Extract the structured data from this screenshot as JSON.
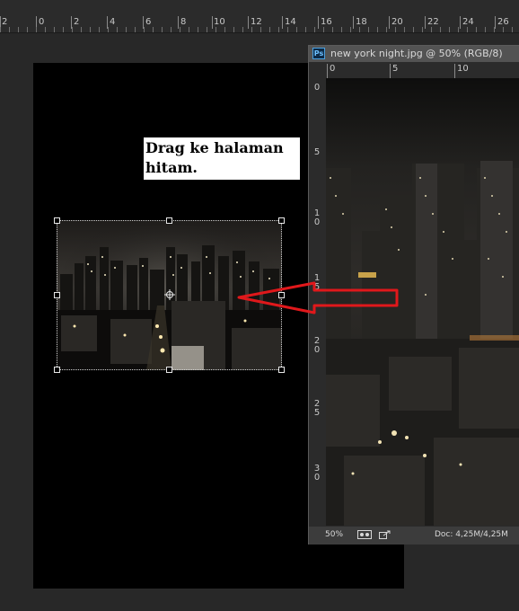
{
  "ruler_top": {
    "labels": [
      "2",
      "0",
      "2",
      "4",
      "6",
      "8",
      "10",
      "12",
      "14",
      "16",
      "18",
      "20",
      "22",
      "24",
      "26"
    ]
  },
  "annotation": {
    "line1": "Drag ke halaman",
    "line2": "hitam."
  },
  "document": {
    "badge": "Ps",
    "title": "new york night.jpg @ 50% (RGB/8)",
    "hruler_labels": [
      "0",
      "5",
      "10"
    ],
    "vruler_labels": [
      "0",
      "5",
      "1\n0",
      "1\n5",
      "2\n0",
      "2\n5",
      "3\n0"
    ],
    "zoom": "50%",
    "doc_info": "Doc: 4,25M/4,25M",
    "icons": [
      "preview-icon",
      "share-arrow-icon"
    ]
  },
  "colors": {
    "arrow": "#e0181b",
    "canvas": "#000000",
    "app_bg": "#282828"
  }
}
